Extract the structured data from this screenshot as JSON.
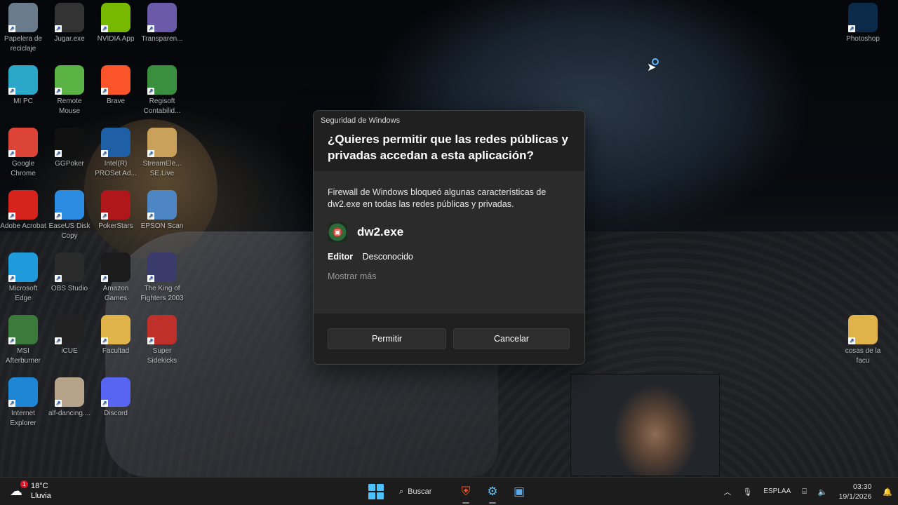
{
  "desktop": {
    "icons": [
      {
        "label": "Papelera de reciclaje",
        "icon": "recycle-bin-icon",
        "color": "#6a7b8c"
      },
      {
        "label": "Jugar.exe",
        "icon": "game-launcher-icon",
        "color": "#333333"
      },
      {
        "label": "NVIDIA App",
        "icon": "nvidia-icon",
        "color": "#76b900"
      },
      {
        "label": "Transparen...",
        "icon": "chat-bubble-icon",
        "color": "#6b5aa8"
      },
      {
        "label": "MI PC",
        "icon": "monitor-icon",
        "color": "#2aa7c9"
      },
      {
        "label": "Remote Mouse",
        "icon": "remote-mouse-icon",
        "color": "#5bb346"
      },
      {
        "label": "Brave",
        "icon": "brave-lion-icon",
        "color": "#fb542b"
      },
      {
        "label": "Regisoft Contabilid...",
        "icon": "rcg-icon",
        "color": "#3a8f3e"
      },
      {
        "label": "Google Chrome",
        "icon": "chrome-icon",
        "color": "#db4437"
      },
      {
        "label": "GGPoker",
        "icon": "ggpoker-icon",
        "color": "#111111"
      },
      {
        "label": "Intel(R) PROSet Ad...",
        "icon": "intel-network-icon",
        "color": "#1f5fa6"
      },
      {
        "label": "StreamEle... SE.Live",
        "icon": "streamelements-icon",
        "color": "#c9a15a"
      },
      {
        "label": "Adobe Acrobat",
        "icon": "acrobat-icon",
        "color": "#d6241c"
      },
      {
        "label": "EaseUS Disk Copy",
        "icon": "easeus-icon",
        "color": "#2a8be0"
      },
      {
        "label": "PokerStars",
        "icon": "pokerstars-icon",
        "color": "#b0171b"
      },
      {
        "label": "EPSON Scan",
        "icon": "scanner-icon",
        "color": "#4e86c4"
      },
      {
        "label": "Microsoft Edge",
        "icon": "edge-icon",
        "color": "#1f9bdb"
      },
      {
        "label": "OBS Studio",
        "icon": "obs-icon",
        "color": "#2b2b2b"
      },
      {
        "label": "Amazon Games",
        "icon": "amazon-games-icon",
        "color": "#1b1b1b"
      },
      {
        "label": "The King of Fighters 2003",
        "icon": "kof-icon",
        "color": "#3b3b6b"
      },
      {
        "label": "MSI Afterburner",
        "icon": "msi-icon",
        "color": "#3c7a3c"
      },
      {
        "label": "iCUE",
        "icon": "icue-icon",
        "color": "#222222"
      },
      {
        "label": "Facultad",
        "icon": "folder-icon",
        "color": "#e0b24a"
      },
      {
        "label": "Super Sidekicks",
        "icon": "neogeo-icon",
        "color": "#c0302a"
      },
      {
        "label": "Internet Explorer",
        "icon": "ie-icon",
        "color": "#1d87d6"
      },
      {
        "label": "alf-dancing....",
        "icon": "image-thumb-icon",
        "color": "#b7a38a"
      },
      {
        "label": "Discord",
        "icon": "discord-icon",
        "color": "#5865f2"
      },
      {
        "label": "Photoshop",
        "icon": "photoshop-icon",
        "color": "#0c2a4a"
      },
      {
        "label": "cosas de la facu",
        "icon": "folder-icon",
        "color": "#e0b24a"
      }
    ]
  },
  "dialog": {
    "caption": "Seguridad de Windows",
    "question": "¿Quieres permitir que las redes públicas y privadas accedan a esta aplicación?",
    "message": "Firewall de Windows bloqueó algunas características de dw2.exe en todas las redes públicas y privadas.",
    "app_name": "dw2.exe",
    "publisher_label": "Editor",
    "publisher_value": "Desconocido",
    "more_link": "Mostrar más",
    "allow_button": "Permitir",
    "cancel_button": "Cancelar"
  },
  "taskbar": {
    "weather_temp": "18°C",
    "weather_desc": "Lluvia",
    "weather_badge": "1",
    "search_label": "Buscar",
    "lang_line1": "ESP",
    "lang_line2": "LAA",
    "time": "03:30",
    "date": "19/1/2026"
  }
}
